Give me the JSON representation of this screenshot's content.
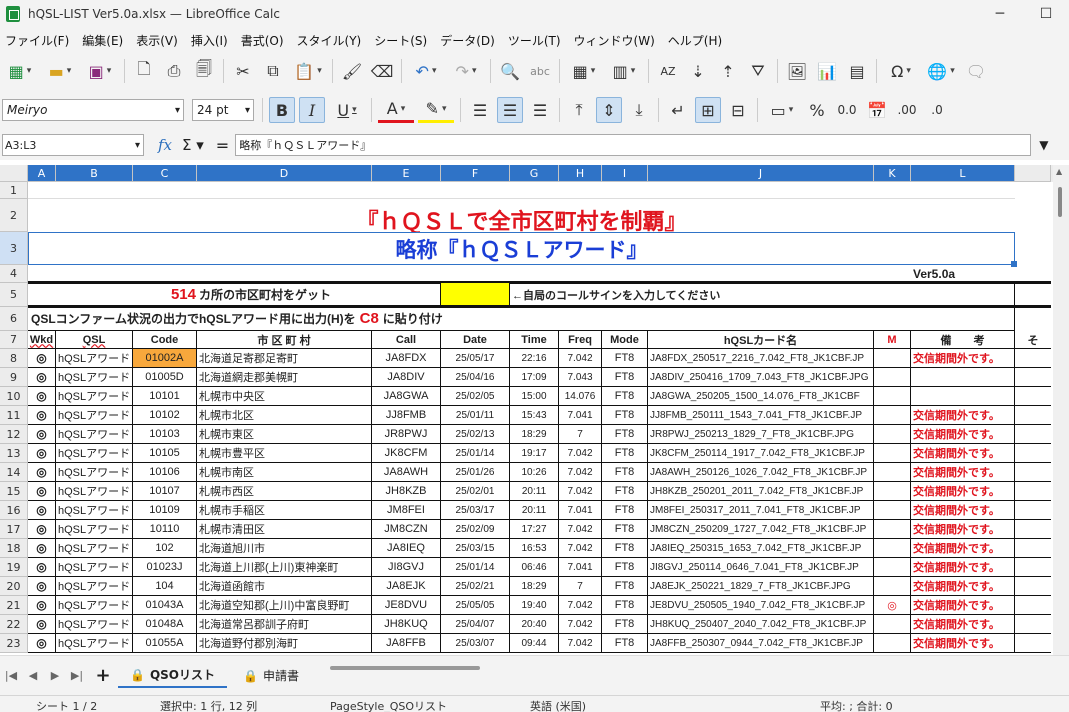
{
  "window": {
    "title": "hQSL-LIST Ver5.0a.xlsx — LibreOffice Calc",
    "min_icon": "minimize-icon",
    "max_icon": "maximize-icon"
  },
  "menu": [
    "ファイル(F)",
    "編集(E)",
    "表示(V)",
    "挿入(I)",
    "書式(O)",
    "スタイル(Y)",
    "シート(S)",
    "データ(D)",
    "ツール(T)",
    "ウィンドウ(W)",
    "ヘルプ(H)"
  ],
  "format": {
    "font_name": "Meiryo",
    "font_size": "24 pt"
  },
  "formula": {
    "name_box": "A3:L3",
    "content": "略称『ｈＱＳＬアワード』"
  },
  "columns": [
    "A",
    "B",
    "C",
    "D",
    "E",
    "F",
    "G",
    "H",
    "I",
    "J",
    "K",
    "L"
  ],
  "rows_visible": [
    "1",
    "2",
    "3",
    "4",
    "5",
    "6",
    "7",
    "8",
    "9",
    "10",
    "11",
    "12",
    "13",
    "14",
    "15",
    "16",
    "17",
    "18",
    "19",
    "20",
    "21",
    "22",
    "23"
  ],
  "sheet": {
    "title": "『ｈＱＳＬで全市区町村を制覇』",
    "subtitle": "略称『ｈＱＳＬアワード』",
    "version": "Ver5.0a",
    "count": "514",
    "count_label": "カ所の市区町村をゲット",
    "callsign_note": "←自局のコールサインを入力してください",
    "instruction_pre": "QSLコンファーム状況の出力でhQSLアワード用に出力(H)を",
    "instruction_cell": "C8",
    "instruction_post": "に貼り付け"
  },
  "headers": {
    "wkd": "Wkd",
    "qsl": "QSL",
    "code": "Code",
    "city": "市 区 町 村",
    "call": "Call",
    "date": "Date",
    "time": "Time",
    "freq": "Freq",
    "mode": "Mode",
    "card": "hQSLカード名",
    "m": "M",
    "note": "備　　考",
    "overflow": "そ"
  },
  "rows": [
    {
      "wkd": "◎",
      "qsl": "hQSLアワード",
      "code": "01002A",
      "city": "北海道足寄郡足寄町",
      "call": "JA8FDX",
      "date": "25/05/17",
      "time": "22:16",
      "freq": "7.042",
      "mode": "FT8",
      "card": "JA8FDX_250517_2216_7.042_FT8_JK1CBF.JP",
      "m": "",
      "note": "交信期間外です。"
    },
    {
      "wkd": "◎",
      "qsl": "hQSLアワード",
      "code": "01005D",
      "city": "北海道網走郡美幌町",
      "call": "JA8DIV",
      "date": "25/04/16",
      "time": "17:09",
      "freq": "7.043",
      "mode": "FT8",
      "card": "JA8DIV_250416_1709_7.043_FT8_JK1CBF.JPG",
      "m": "",
      "note": ""
    },
    {
      "wkd": "◎",
      "qsl": "hQSLアワード",
      "code": "10101",
      "city": "札幌市中央区",
      "call": "JA8GWA",
      "date": "25/02/05",
      "time": "15:00",
      "freq": "14.076",
      "mode": "FT8",
      "card": "JA8GWA_250205_1500_14.076_FT8_JK1CBF",
      "m": "",
      "note": ""
    },
    {
      "wkd": "◎",
      "qsl": "hQSLアワード",
      "code": "10102",
      "city": "札幌市北区",
      "call": "JJ8FMB",
      "date": "25/01/11",
      "time": "15:43",
      "freq": "7.041",
      "mode": "FT8",
      "card": "JJ8FMB_250111_1543_7.041_FT8_JK1CBF.JP",
      "m": "",
      "note": "交信期間外です。"
    },
    {
      "wkd": "◎",
      "qsl": "hQSLアワード",
      "code": "10103",
      "city": "札幌市東区",
      "call": "JR8PWJ",
      "date": "25/02/13",
      "time": "18:29",
      "freq": "7",
      "mode": "FT8",
      "card": "JR8PWJ_250213_1829_7_FT8_JK1CBF.JPG",
      "m": "",
      "note": "交信期間外です。"
    },
    {
      "wkd": "◎",
      "qsl": "hQSLアワード",
      "code": "10105",
      "city": "札幌市豊平区",
      "call": "JK8CFM",
      "date": "25/01/14",
      "time": "19:17",
      "freq": "7.042",
      "mode": "FT8",
      "card": "JK8CFM_250114_1917_7.042_FT8_JK1CBF.JP",
      "m": "",
      "note": "交信期間外です。"
    },
    {
      "wkd": "◎",
      "qsl": "hQSLアワード",
      "code": "10106",
      "city": "札幌市南区",
      "call": "JA8AWH",
      "date": "25/01/26",
      "time": "10:26",
      "freq": "7.042",
      "mode": "FT8",
      "card": "JA8AWH_250126_1026_7.042_FT8_JK1CBF.JP",
      "m": "",
      "note": "交信期間外です。"
    },
    {
      "wkd": "◎",
      "qsl": "hQSLアワード",
      "code": "10107",
      "city": "札幌市西区",
      "call": "JH8KZB",
      "date": "25/02/01",
      "time": "20:11",
      "freq": "7.042",
      "mode": "FT8",
      "card": "JH8KZB_250201_2011_7.042_FT8_JK1CBF.JP",
      "m": "",
      "note": "交信期間外です。"
    },
    {
      "wkd": "◎",
      "qsl": "hQSLアワード",
      "code": "10109",
      "city": "札幌市手稲区",
      "call": "JM8FEI",
      "date": "25/03/17",
      "time": "20:11",
      "freq": "7.041",
      "mode": "FT8",
      "card": "JM8FEI_250317_2011_7.041_FT8_JK1CBF.JP",
      "m": "",
      "note": "交信期間外です。"
    },
    {
      "wkd": "◎",
      "qsl": "hQSLアワード",
      "code": "10110",
      "city": "札幌市清田区",
      "call": "JM8CZN",
      "date": "25/02/09",
      "time": "17:27",
      "freq": "7.042",
      "mode": "FT8",
      "card": "JM8CZN_250209_1727_7.042_FT8_JK1CBF.JP",
      "m": "",
      "note": "交信期間外です。"
    },
    {
      "wkd": "◎",
      "qsl": "hQSLアワード",
      "code": "102",
      "city": "北海道旭川市",
      "call": "JA8IEQ",
      "date": "25/03/15",
      "time": "16:53",
      "freq": "7.042",
      "mode": "FT8",
      "card": "JA8IEQ_250315_1653_7.042_FT8_JK1CBF.JP",
      "m": "",
      "note": "交信期間外です。"
    },
    {
      "wkd": "◎",
      "qsl": "hQSLアワード",
      "code": "01023J",
      "city": "北海道上川郡(上川)東神楽町",
      "call": "JI8GVJ",
      "date": "25/01/14",
      "time": "06:46",
      "freq": "7.041",
      "mode": "FT8",
      "card": "JI8GVJ_250114_0646_7.041_FT8_JK1CBF.JP",
      "m": "",
      "note": "交信期間外です。"
    },
    {
      "wkd": "◎",
      "qsl": "hQSLアワード",
      "code": "104",
      "city": "北海道函館市",
      "call": "JA8EJK",
      "date": "25/02/21",
      "time": "18:29",
      "freq": "7",
      "mode": "FT8",
      "card": "JA8EJK_250221_1829_7_FT8_JK1CBF.JPG",
      "m": "",
      "note": "交信期間外です。"
    },
    {
      "wkd": "◎",
      "qsl": "hQSLアワード",
      "code": "01043A",
      "city": "北海道空知郡(上川)中富良野町",
      "call": "JE8DVU",
      "date": "25/05/05",
      "time": "19:40",
      "freq": "7.042",
      "mode": "FT8",
      "card": "JE8DVU_250505_1940_7.042_FT8_JK1CBF.JP",
      "m": "◎",
      "note": "交信期間外です。"
    },
    {
      "wkd": "◎",
      "qsl": "hQSLアワード",
      "code": "01048A",
      "city": "北海道常呂郡訓子府町",
      "call": "JH8KUQ",
      "date": "25/04/07",
      "time": "20:40",
      "freq": "7.042",
      "mode": "FT8",
      "card": "JH8KUQ_250407_2040_7.042_FT8_JK1CBF.JP",
      "m": "",
      "note": "交信期間外です。"
    },
    {
      "wkd": "◎",
      "qsl": "hQSLアワード",
      "code": "01055A",
      "city": "北海道野付郡別海町",
      "call": "JA8FFB",
      "date": "25/03/07",
      "time": "09:44",
      "freq": "7.042",
      "mode": "FT8",
      "card": "JA8FFB_250307_0944_7.042_FT8_JK1CBF.JP",
      "m": "",
      "note": "交信期間外です。"
    }
  ],
  "tabs": {
    "sheet1": "QSOリスト",
    "sheet2": "申請書"
  },
  "status": {
    "sheet": "シート 1 / 2",
    "selection": "選択中: 1 行, 12 列",
    "pagestyle": "PageStyle_QSOリスト",
    "language": "英語 (米国)",
    "summary": "平均: ; 合計: 0"
  },
  "colors": {
    "accent": "#2f73c7",
    "title_red": "#e0141e",
    "subtitle_blue": "#1a3ed6",
    "highlight_orange": "#f8a83c",
    "input_yellow": "#ffff00"
  }
}
